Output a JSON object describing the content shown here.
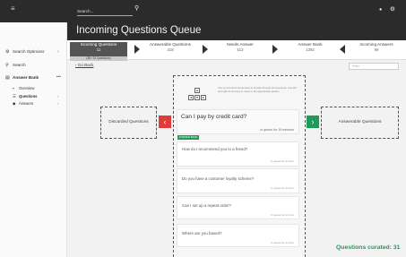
{
  "topbar": {
    "menu_icon": "≡",
    "search_placeholder": "Search...",
    "search_icon": "⚲",
    "bell_icon": "●",
    "gear_icon": "⚙"
  },
  "page": {
    "title": "Incoming Questions Queue"
  },
  "sidebar": {
    "optimizer": {
      "label": "Search Optimizer",
      "icon": "gear-icon",
      "chevron": "‹"
    },
    "search": {
      "label": "Search",
      "icon": "search-icon"
    },
    "answer_bank": {
      "label": "Answer Bank",
      "icon": "bank-icon",
      "dots": "•••"
    },
    "items": [
      {
        "label": "Overview",
        "icon": "grid-icon"
      },
      {
        "label": "Questions",
        "icon": "list-icon",
        "chevron": "›"
      },
      {
        "label": "Answers",
        "icon": "chat-icon",
        "chevron": "›"
      }
    ]
  },
  "pipeline": {
    "stages": [
      {
        "label": "Incoming Questions",
        "count": "11",
        "sub": "(28 / 31 Questions)"
      },
      {
        "label": "Answerable Questions",
        "count": "318"
      },
      {
        "label": "Needs Answer",
        "count": "113"
      },
      {
        "label": "Answer Bank",
        "count": "1292"
      },
      {
        "label": "Incoming Answers",
        "count": "99"
      }
    ]
  },
  "content": {
    "go_back": "‹ Go Back",
    "filter_placeholder": "Filter",
    "discarded_label": "Discarded Questions",
    "answerable_label": "Answerable Questions",
    "hint": "Use up and down arrow keys to browse through the questions. Use left and right arrow keys to move to the appropriate section.",
    "current_question": "Can I pay by credit card?",
    "current_meta": "In queue for 19 minutes",
    "badge": "ANSWER BANK",
    "questions": [
      {
        "text": "How do I recommend you to a friend?",
        "meta": "In queue for an hour"
      },
      {
        "text": "Do you have a customer loyalty scheme?",
        "meta": "In queue for an hour"
      },
      {
        "text": "Can I set up a repeat order?",
        "meta": "In queue for an hour"
      },
      {
        "text": "Where are you based?",
        "meta": "In queue for an hour"
      }
    ],
    "curated": "Questions curated: 31"
  },
  "colors": {
    "accent_green": "#1f9a58",
    "accent_red": "#e03b3b",
    "dark": "#2b2b2b"
  }
}
